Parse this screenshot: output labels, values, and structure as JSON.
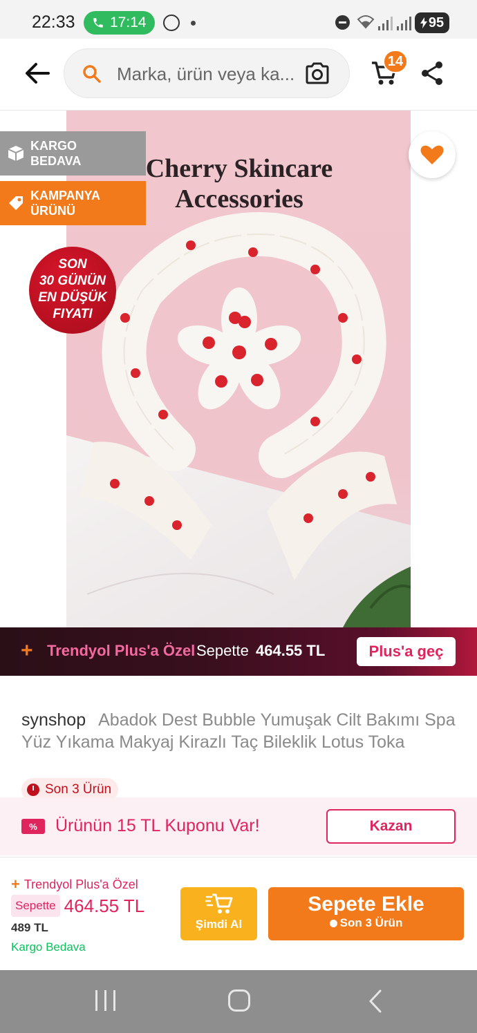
{
  "status_bar": {
    "time": "22:33",
    "call_timer": "17:14",
    "battery": "95"
  },
  "header": {
    "search_placeholder": "Marka, ürün veya ka...",
    "cart_count": "14"
  },
  "product_image": {
    "badge_shipping": [
      "KARGO",
      "BEDAVA"
    ],
    "badge_campaign": [
      "KAMPANYA",
      "ÜRÜNÜ"
    ],
    "lowest_price_badge": [
      "SON",
      "30 GÜNÜN",
      "EN DÜŞÜK",
      "FIYATI"
    ],
    "photo_heading": [
      "Cherry Skincare",
      "Accessories"
    ]
  },
  "plus_banner": {
    "title": "Trendyol Plus'a Özel",
    "sepette_label": "Sepette",
    "price": "464.55 TL",
    "button": "Plus'a geç"
  },
  "product": {
    "brand": "synshop",
    "name": "Abadok Dest Bubble Yumuşak Cilt Bakımı Spa Yüz Yıkama Makyaj Kirazlı Taç Bileklik Lotus Toka",
    "stock": "Son 3 Ürün"
  },
  "coupon": {
    "icon_text": "%",
    "text": "Ürünün 15 TL Kuponu Var!",
    "button": "Kazan"
  },
  "bottom_bar": {
    "plus_label": "Trendyol Plus'a Özel",
    "sepette_label": "Sepette",
    "plus_price": "464.55 TL",
    "old_price": "489 TL",
    "shipping": "Kargo Bedava",
    "buy_now": "Şimdi Al",
    "add_to_cart": "Sepete Ekle",
    "add_to_cart_sub": "Son 3 Ürün"
  },
  "colors": {
    "brand_orange": "#f27a1a",
    "plus_pink": "#e0245e",
    "buy_now_yellow": "#f9b21d",
    "free_shipping_green": "#0bc15c"
  }
}
